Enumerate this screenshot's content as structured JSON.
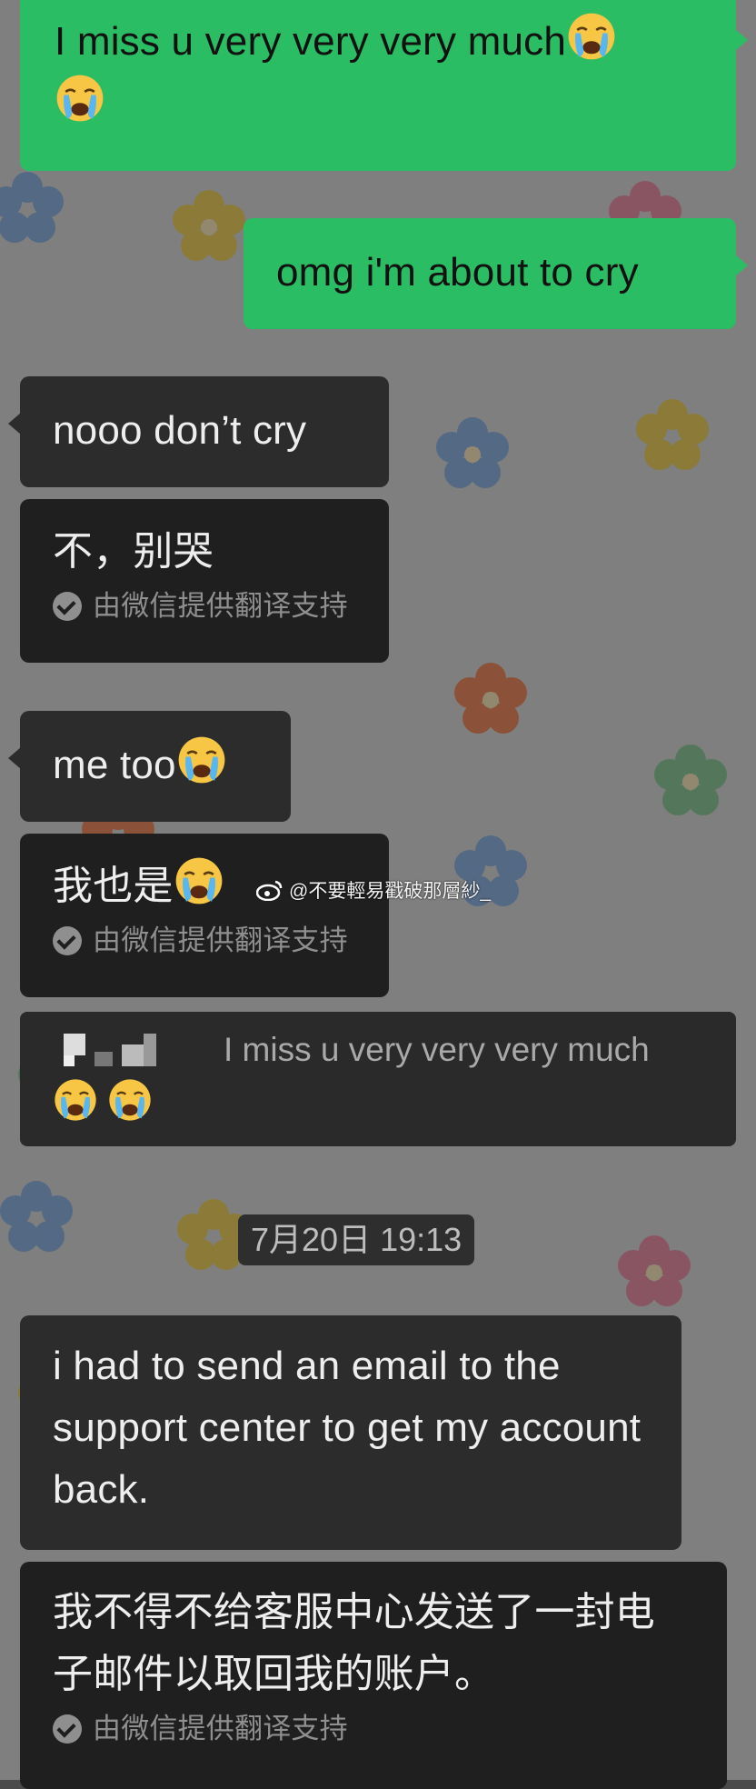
{
  "messages": [
    {
      "text": "I miss u very very very much"
    },
    {
      "text": "omg i'm about to cry"
    },
    {
      "text": "nooo don’t cry"
    },
    {
      "text": "不，别哭",
      "attribution": "由微信提供翻译支持"
    },
    {
      "text": "me too"
    },
    {
      "text": "我也是",
      "attribution": "由微信提供翻译支持"
    },
    {
      "quote": "I miss u very very very much"
    },
    {
      "timestamp": "7月20日 19:13"
    },
    {
      "text": "i had to send an email to the support center to get my account back."
    },
    {
      "text": "我不得不给客服中心发送了一封电子邮件以取回我的账户。",
      "attribution": "由微信提供翻译支持"
    }
  ],
  "watermark": "@不要輕易戳破那層紗_",
  "icons": {
    "emoji": "loudly-crying-face",
    "check": "check-circle-icon",
    "weibo": "weibo-icon"
  },
  "colors": {
    "sent_bubble": "#2bbd63",
    "received_bubble": "#2c2c2c",
    "translation_bubble": "#1f1f1f"
  }
}
